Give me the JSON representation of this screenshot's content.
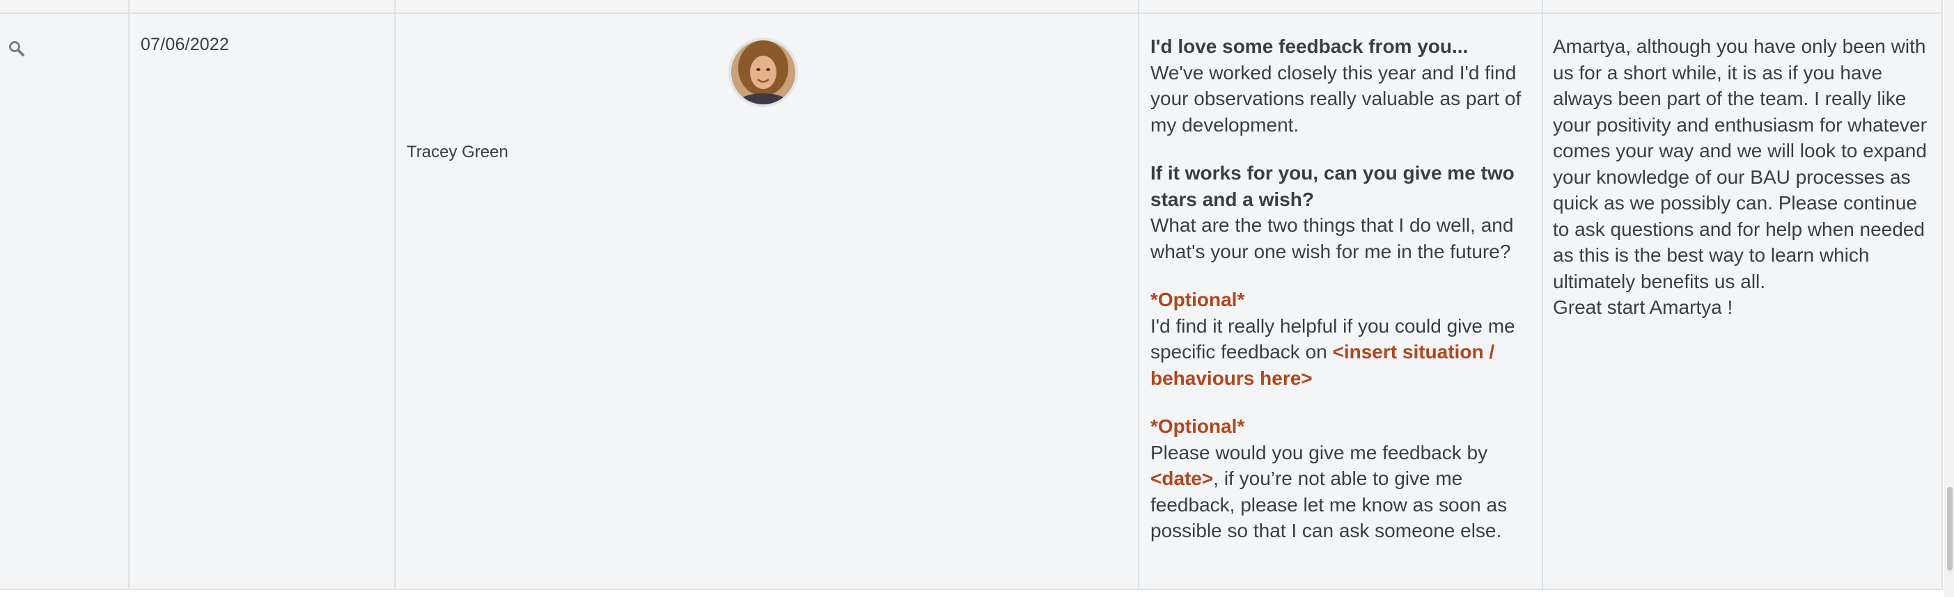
{
  "row": {
    "date": "07/06/2022",
    "person": {
      "name": "Tracey Green"
    },
    "request": {
      "heading_1": "I'd love some feedback from you...",
      "para_1": "We've worked closely this year and I'd find your observations really valuable as part of my development.",
      "heading_2": "If it works for you, can you give me two stars and a wish?",
      "para_2": "What are the two things that I do well, and what's your one wish for me in the future?",
      "optional_label_1": "*Optional*",
      "para_3_prefix": "I'd find it really helpful if you could give me specific feedback on ",
      "para_3_placeholder": "<insert situation / behaviours here>",
      "optional_label_2": "*Optional*",
      "para_4_prefix": "Please would you give me feedback by ",
      "para_4_placeholder": "<date>",
      "para_4_suffix": ", if you’re not able to give me feedback, please let me know as soon as possible so that I can ask someone else."
    },
    "response": {
      "body": "Amartya, although you have only been with us for a short while, it is as if you have always been part of the team. I really like your positivity and enthusiasm for whatever comes your way and we will look to expand your knowledge of our BAU processes as quick as we possibly can. Please continue to ask questions and for help when needed as this is the best way to learn which ultimately benefits us all.",
      "closing": "Great start Amartya !"
    }
  },
  "icons": {
    "view": "magnifier-icon"
  },
  "colors": {
    "accent": "#b2461b",
    "text": "#3b3e41",
    "row_bg": "#f4f5f6",
    "divider": "#dfe1e3"
  }
}
